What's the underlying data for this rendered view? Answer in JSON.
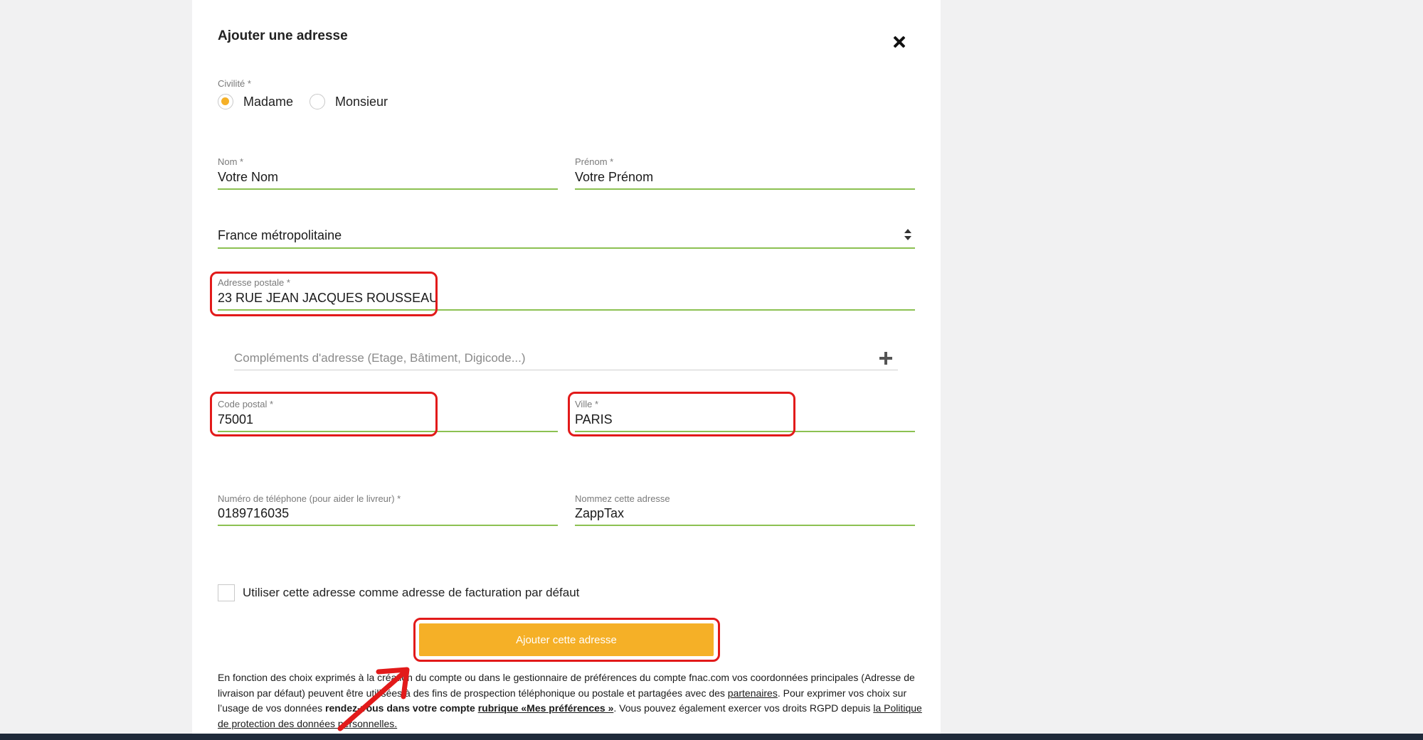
{
  "form": {
    "title": "Ajouter une adresse",
    "close_icon": "close-icon",
    "civility": {
      "label": "Civilité *",
      "options": [
        "Madame",
        "Monsieur"
      ],
      "selected": "Madame"
    },
    "nom": {
      "label": "Nom *",
      "value": "Votre Nom"
    },
    "prenom": {
      "label": "Prénom *",
      "value": "Votre Prénom"
    },
    "country": {
      "value": "France métropolitaine"
    },
    "adresse": {
      "label": "Adresse postale *",
      "value": "23 RUE JEAN JACQUES ROUSSEAU"
    },
    "complements": {
      "placeholder": "Compléments d'adresse (Etage, Bâtiment, Digicode...)"
    },
    "code_postal": {
      "label": "Code postal *",
      "value": "75001"
    },
    "ville": {
      "label": "Ville *",
      "value": "PARIS"
    },
    "telephone": {
      "label": "Numéro de téléphone (pour aider le livreur) *",
      "value": "0189716035"
    },
    "nom_adresse": {
      "label": "Nommez cette adresse",
      "value": "ZappTax"
    },
    "billing_checkbox": {
      "label": "Utiliser cette adresse comme adresse de facturation par défaut",
      "checked": false
    },
    "submit_label": "Ajouter cette adresse"
  },
  "legal": {
    "p1": "En fonction des choix exprimés à la création du compte ou dans le gestionnaire de préférences du compte fnac.com vos coordonnées principales (Adresse de livraison par défaut) peuvent être utilisées à des fins de prospection téléphonique ou postale et partagées avec des ",
    "link_partenaires": "partenaires",
    "p2": ". Pour exprimer vos choix sur l’usage de vos données ",
    "bold_rendez_vous": "rendez-vous dans votre compte ",
    "link_preferences": "rubrique «Mes préférences »",
    "p3": ". Vous pouvez également exercer vos droits RGPD depuis ",
    "link_politique": "la Politique de protection des données personnelles."
  },
  "colors": {
    "accent": "#f5b027",
    "field_underline": "#8cc152",
    "annotation": "#e21a1a"
  }
}
